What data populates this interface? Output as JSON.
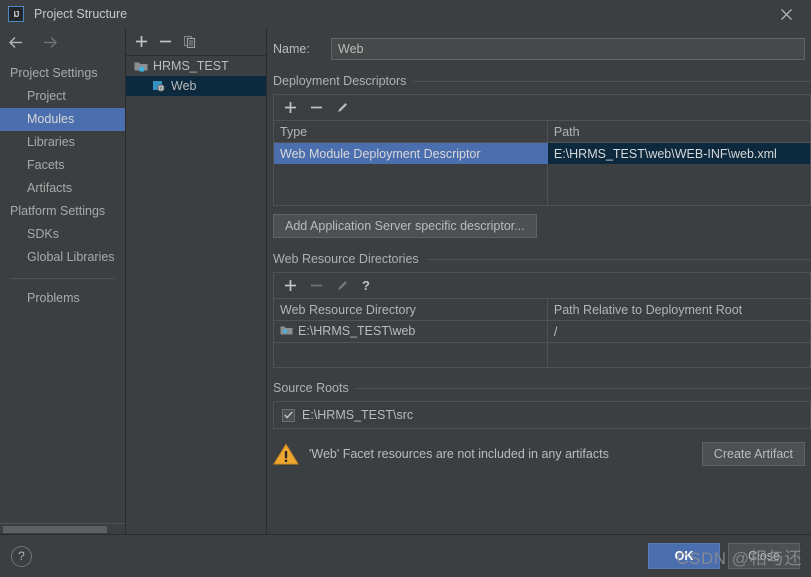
{
  "window": {
    "title": "Project Structure",
    "logo_text": "IJ",
    "close_icon": "close-icon"
  },
  "sidebar": {
    "nav": {
      "back_icon": "arrow-left-icon",
      "forward_icon": "arrow-right-icon"
    },
    "items": [
      {
        "label": "Project Settings",
        "type": "group",
        "selected": false
      },
      {
        "label": "Project",
        "type": "child",
        "selected": false
      },
      {
        "label": "Modules",
        "type": "child",
        "selected": true
      },
      {
        "label": "Libraries",
        "type": "child",
        "selected": false
      },
      {
        "label": "Facets",
        "type": "child",
        "selected": false
      },
      {
        "label": "Artifacts",
        "type": "child",
        "selected": false
      },
      {
        "label": "Platform Settings",
        "type": "group",
        "selected": false
      },
      {
        "label": "SDKs",
        "type": "child",
        "selected": false
      },
      {
        "label": "Global Libraries",
        "type": "child",
        "selected": false
      }
    ],
    "problems_label": "Problems"
  },
  "tree_panel": {
    "toolbar": [
      {
        "name": "add-module-button",
        "glyph": "+"
      },
      {
        "name": "remove-module-button",
        "glyph": "−"
      },
      {
        "name": "copy-module-button",
        "glyph": "copy-icon"
      }
    ],
    "nodes": [
      {
        "label": "HRMS_TEST",
        "level": 0,
        "icon": "module-folder-icon",
        "selected": false
      },
      {
        "label": "Web",
        "level": 1,
        "icon": "web-facet-icon",
        "selected": true
      }
    ]
  },
  "content": {
    "name_field": {
      "label": "Name:",
      "value": "Web",
      "placeholder": ""
    },
    "deployment_descriptors": {
      "title": "Deployment Descriptors",
      "toolbar": [
        {
          "name": "add-descriptor-button",
          "glyph": "+",
          "enabled": true
        },
        {
          "name": "remove-descriptor-button",
          "glyph": "−",
          "enabled": true
        },
        {
          "name": "edit-descriptor-button",
          "glyph": "pencil-icon",
          "enabled": true
        }
      ],
      "columns": [
        "Type",
        "Path"
      ],
      "rows": [
        {
          "type": "Web Module Deployment Descriptor",
          "path": "E:\\HRMS_TEST\\web\\WEB-INF\\web.xml",
          "selected": true
        }
      ],
      "add_button_label": "Add Application Server specific descriptor..."
    },
    "web_resource_directories": {
      "title": "Web Resource Directories",
      "toolbar": [
        {
          "name": "add-web-resource-button",
          "glyph": "+",
          "enabled": true
        },
        {
          "name": "remove-web-resource-button",
          "glyph": "−",
          "enabled": false
        },
        {
          "name": "edit-web-resource-button",
          "glyph": "pencil-icon",
          "enabled": false
        },
        {
          "name": "web-resource-help-button",
          "glyph": "?",
          "enabled": true
        }
      ],
      "columns": [
        "Web Resource Directory",
        "Path Relative to Deployment Root"
      ],
      "rows": [
        {
          "directory": "E:\\HRMS_TEST\\web",
          "relative_path": "/",
          "icon": "folder-icon"
        }
      ]
    },
    "source_roots": {
      "title": "Source Roots",
      "rows": [
        {
          "label": "E:\\HRMS_TEST\\src",
          "checked": true
        }
      ]
    },
    "warning": {
      "icon": "warning-triangle-icon",
      "message": "'Web' Facet resources are not included in any artifacts",
      "action_label": "Create Artifact"
    }
  },
  "footer": {
    "help_label": "?",
    "ok_label": "OK",
    "close_label": "Close",
    "watermark": "CSDN @相与还"
  },
  "colors": {
    "background": "#3c3f41",
    "selection_blue": "#4b6eaf",
    "tree_selection": "#0d293e",
    "border": "#4e5254",
    "warning_orange": "#f0a732",
    "text": "#bbbbbb"
  }
}
